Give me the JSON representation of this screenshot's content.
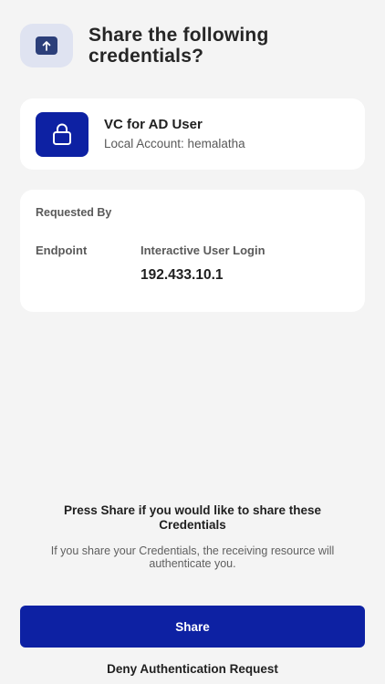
{
  "header": {
    "icon": "upload-arrow-icon",
    "title": "Share the following credentials?"
  },
  "credential": {
    "icon": "lock-icon",
    "title": "VC for AD User",
    "subtitle": "Local Account: hemalatha"
  },
  "request": {
    "label": "Requested By",
    "endpoint_key": "Endpoint",
    "endpoint_type": "Interactive User Login",
    "endpoint_ip": "192.433.10.1"
  },
  "prompt": {
    "main": "Press Share if you would like to share these Credentials",
    "sub": "If you share your Credentials, the receiving resource will authenticate you."
  },
  "actions": {
    "share_label": "Share",
    "deny_label": "Deny Authentication Request"
  },
  "colors": {
    "accent": "#0d21a3",
    "background": "#f4f4f4",
    "card": "#ffffff"
  }
}
